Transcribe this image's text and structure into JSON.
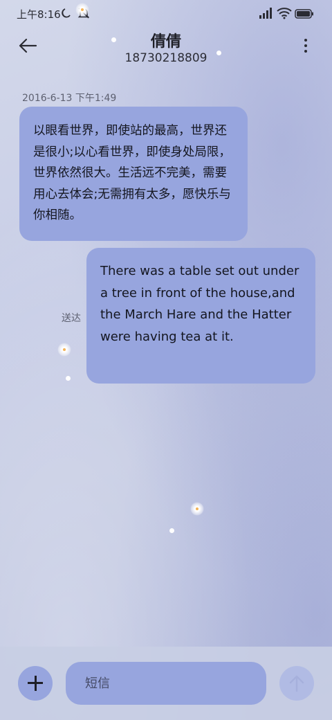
{
  "status_bar": {
    "time": "上午8:16"
  },
  "header": {
    "contact_name": "倩倩",
    "phone_number": "18730218809"
  },
  "conversation": {
    "timestamp": "2016-6-13 下午1:49",
    "messages": [
      {
        "direction": "incoming",
        "text": "以眼看世界，即使站的最高，世界还是很小;以心看世界，即使身处局限，世界依然很大。生活远不完美，需要用心去体会;无需拥有太多，愿快乐与你相随。"
      },
      {
        "direction": "outgoing",
        "text": "There was a table set out under a tree in front of the house,and the March Hare and the Hatter were having tea at it.",
        "status": "送达"
      }
    ]
  },
  "composer": {
    "placeholder": "短信",
    "add_icon": "plus-icon",
    "send_icon": "arrow-up-icon"
  },
  "colors": {
    "bubble": "#97a5de",
    "send_disabled": "#b1bbe4"
  }
}
